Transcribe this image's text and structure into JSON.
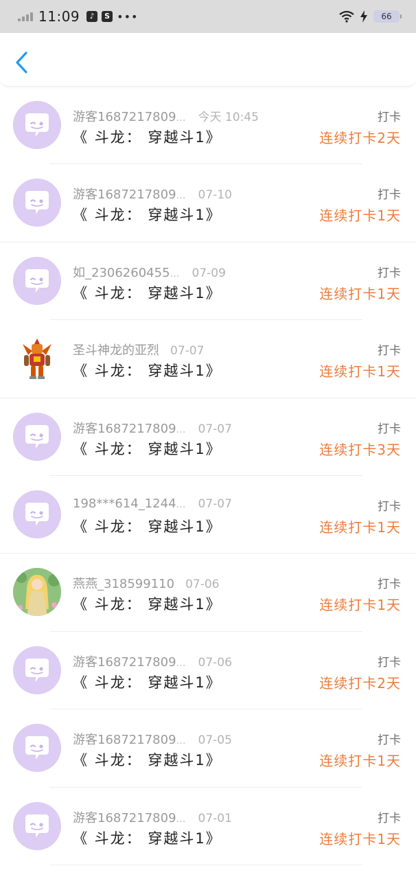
{
  "status_bar": {
    "time": "11:09",
    "battery": "66"
  },
  "rows": [
    {
      "name": "游客1687217809",
      "ellipsis": "…",
      "date": "今天 10:45",
      "title": "《 斗龙： 穿越斗1》",
      "action": "打卡",
      "streak": "连续打卡2天",
      "avatar": "bubble-chat-avatar"
    },
    {
      "name": "游客1687217809",
      "ellipsis": "…",
      "date": "07-10",
      "title": "《 斗龙： 穿越斗1》",
      "action": "打卡",
      "streak": "连续打卡1天",
      "avatar": "bubble-chat-avatar"
    },
    {
      "name": "如_2306260455",
      "ellipsis": "…",
      "date": "07-09",
      "title": "《 斗龙： 穿越斗1》",
      "action": "打卡",
      "streak": "连续打卡1天",
      "avatar": "bubble-chat-avatar"
    },
    {
      "name": "圣斗神龙的亚烈",
      "ellipsis": "",
      "date": "07-07",
      "title": "《 斗龙： 穿越斗1》",
      "action": "打卡",
      "streak": "连续打卡1天",
      "avatar": "robot-avatar"
    },
    {
      "name": "游客1687217809",
      "ellipsis": "…",
      "date": "07-07",
      "title": "《 斗龙： 穿越斗1》",
      "action": "打卡",
      "streak": "连续打卡3天",
      "avatar": "bubble-chat-avatar"
    },
    {
      "name": "198***614_1244",
      "ellipsis": "…",
      "date": "07-07",
      "title": "《 斗龙： 穿越斗1》",
      "action": "打卡",
      "streak": "连续打卡1天",
      "avatar": "bubble-chat-avatar"
    },
    {
      "name": "燕燕_318599110",
      "ellipsis": "",
      "date": "07-06",
      "title": "《 斗龙： 穿越斗1》",
      "action": "打卡",
      "streak": "连续打卡1天",
      "avatar": "girl-avatar"
    },
    {
      "name": "游客1687217809",
      "ellipsis": "…",
      "date": "07-06",
      "title": "《 斗龙： 穿越斗1》",
      "action": "打卡",
      "streak": "连续打卡2天",
      "avatar": "bubble-chat-avatar"
    },
    {
      "name": "游客1687217809",
      "ellipsis": "…",
      "date": "07-05",
      "title": "《 斗龙： 穿越斗1》",
      "action": "打卡",
      "streak": "连续打卡1天",
      "avatar": "bubble-chat-avatar"
    },
    {
      "name": "游客1687217809",
      "ellipsis": "…",
      "date": "07-01",
      "title": "《 斗龙： 穿越斗1》",
      "action": "打卡",
      "streak": "连续打卡1天",
      "avatar": "bubble-chat-avatar"
    }
  ],
  "colors": {
    "accent_blue": "#1e9bf0",
    "streak_orange": "#ee7c3b",
    "avatar_lavender": "#ddccf3"
  }
}
